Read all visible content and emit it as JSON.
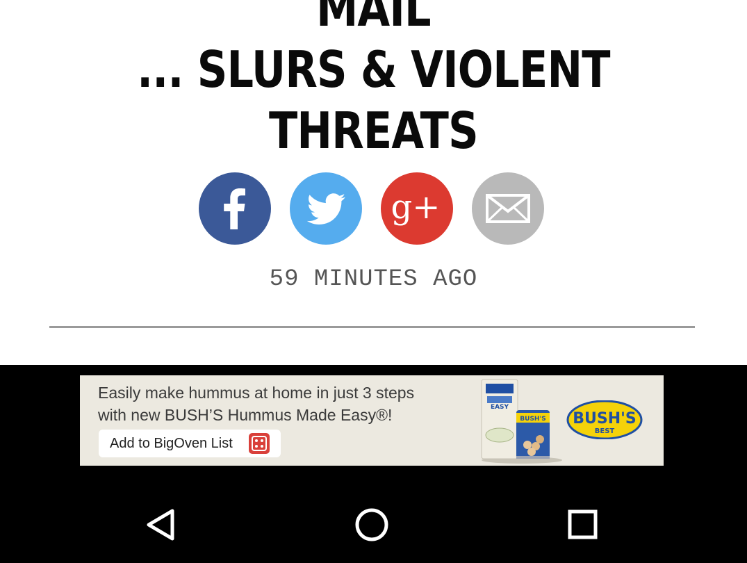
{
  "article": {
    "headline_lines": [
      "MAIL",
      "... SLURS & VIOLENT",
      "THREATS"
    ],
    "share": {
      "facebook": {
        "icon": "facebook-icon",
        "color": "#3b5998"
      },
      "twitter": {
        "icon": "twitter-bird-icon",
        "color": "#55acee"
      },
      "google_plus": {
        "icon": "google-plus-icon",
        "color": "#dc3a30",
        "glyph": "g+"
      },
      "email": {
        "icon": "envelope-icon",
        "color": "#b9b9b9"
      }
    },
    "timestamp": "59 MINUTES AGO"
  },
  "ad": {
    "line1": "Easily make hummus at home in just 3 steps",
    "line2": "with new BUSH’S Hummus Made Easy®!",
    "cta_label": "Add to BigOven List",
    "package_label": "EASY",
    "can_label": "BUSH'S",
    "logo_text": "BUSH'S",
    "logo_subtext": "BEST",
    "colors": {
      "background": "#ece9e0",
      "logo_yellow": "#f5d20a",
      "logo_blue": "#1f4fa3"
    }
  },
  "navbar": {
    "back": "back-triangle-icon",
    "home": "home-circle-icon",
    "recents": "recents-square-icon"
  }
}
